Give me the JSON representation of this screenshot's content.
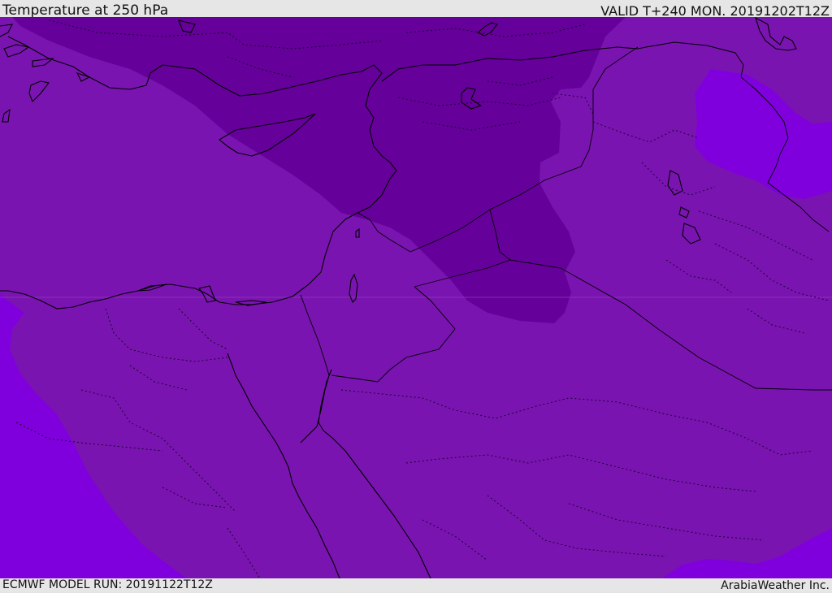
{
  "header": {
    "title": "Temperature at 250 hPa",
    "valid": "VALID T+240 MON. 20191202T12Z"
  },
  "footer": {
    "model_run": "ECMWF MODEL RUN: 20191122T12Z",
    "credit": "ArabiaWeather Inc."
  },
  "map": {
    "field": "temperature-250hPa",
    "colors": {
      "background_band": "#7a14b0",
      "cold_band": "#66009a",
      "warm_band": "#7f00dd",
      "coastline": "#000000"
    }
  }
}
